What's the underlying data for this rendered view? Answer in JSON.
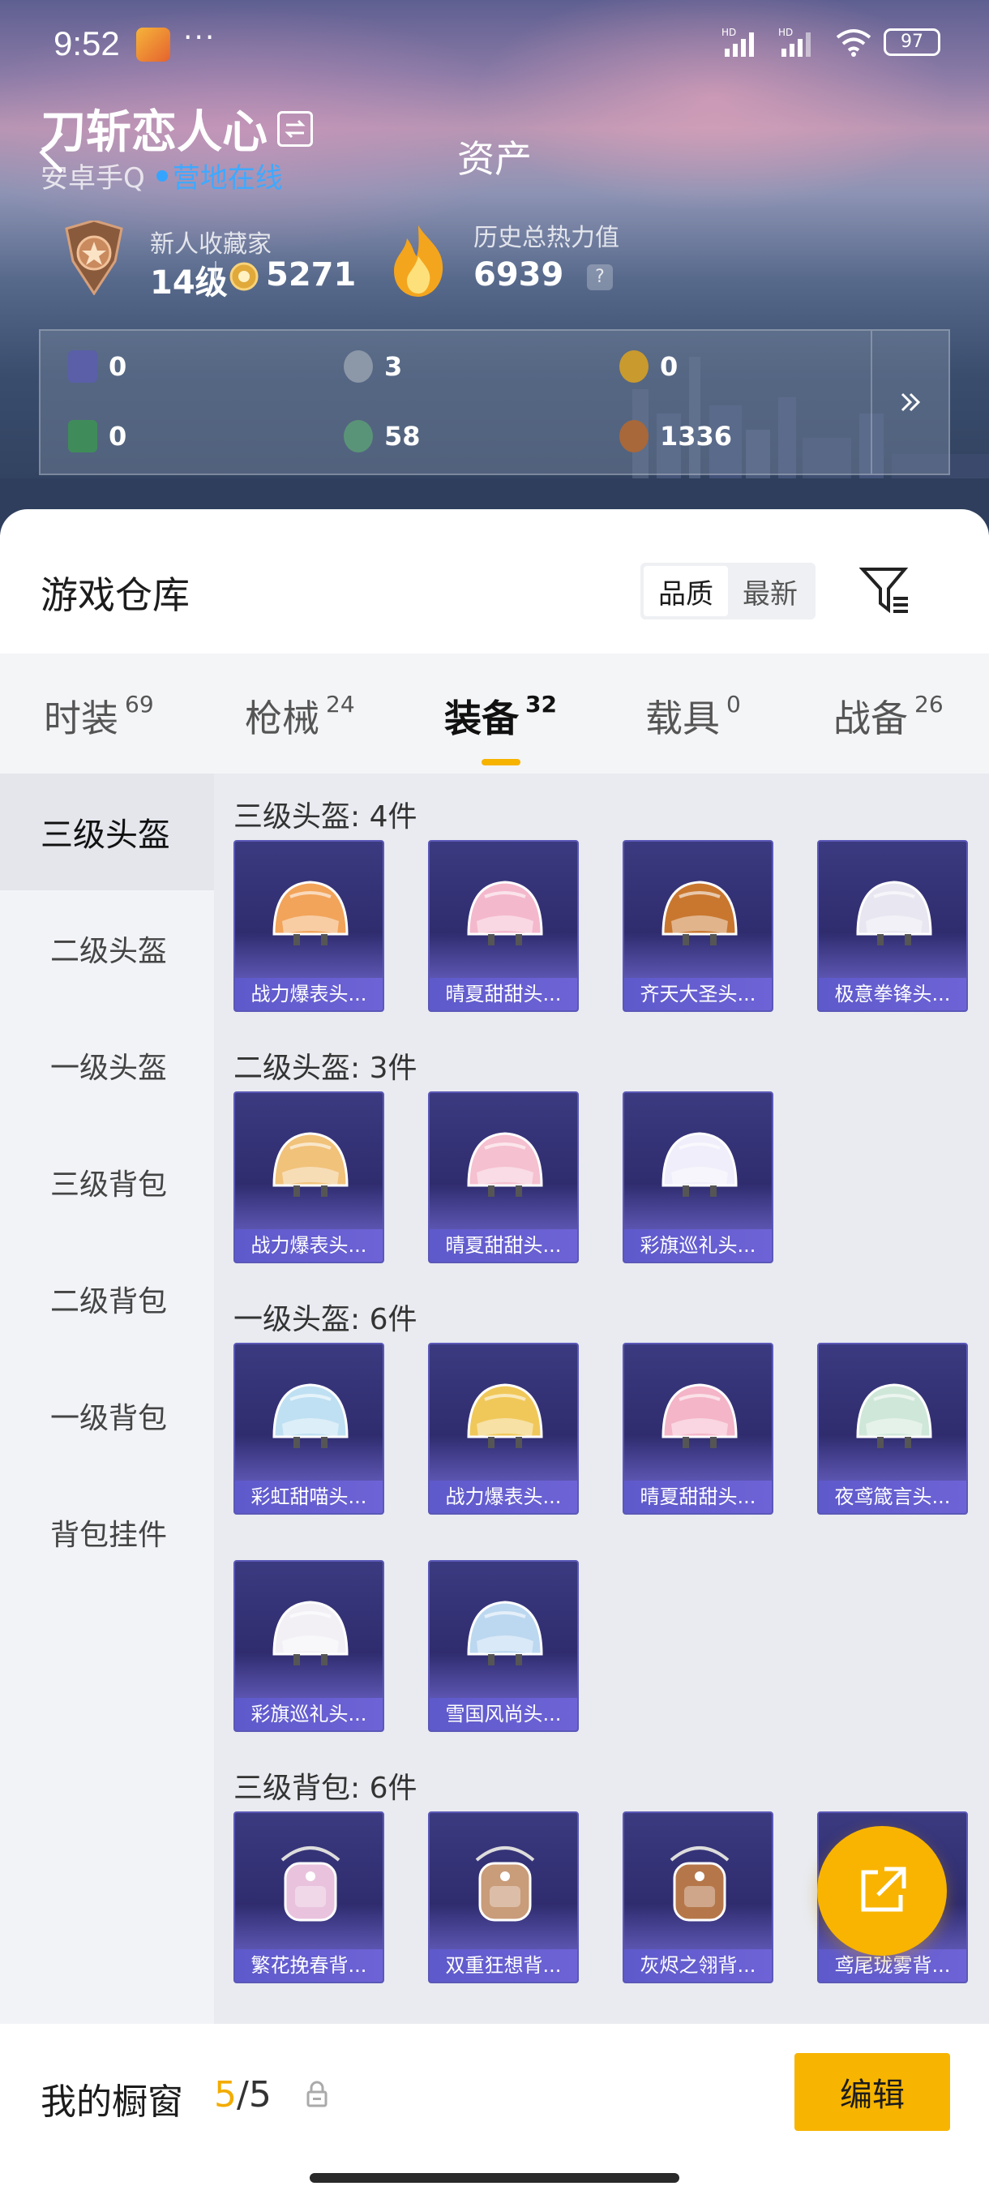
{
  "status_bar": {
    "time": "9:52",
    "dots": "···",
    "network1": "HD",
    "network2": "HD",
    "battery": "97"
  },
  "header": {
    "title": "资产",
    "username": "刀斩恋人心",
    "platform": "安卓手Q",
    "online_status": "营地在线",
    "rank_title": "新人收藏家",
    "rank_level": "14级",
    "rank_points": "5271",
    "heat_title": "历史总热力值",
    "heat_value": "6939",
    "help": "?"
  },
  "currencies": [
    {
      "icon": "card-icon",
      "value": "0",
      "color": "#5a5fa8"
    },
    {
      "icon": "silver-coin-icon",
      "value": "3",
      "color": "#8c97a8"
    },
    {
      "icon": "gold-coin-icon",
      "value": "0",
      "color": "#c99a2e"
    },
    {
      "icon": "green-card-icon",
      "value": "0",
      "color": "#3f8c5a"
    },
    {
      "icon": "green-orb-icon",
      "value": "58",
      "color": "#5a9478"
    },
    {
      "icon": "bronze-coin-icon",
      "value": "1336",
      "color": "#a8683a"
    }
  ],
  "warehouse": {
    "title": "游戏仓库",
    "sort_options": [
      "品质",
      "最新"
    ],
    "active_sort": "品质"
  },
  "tabs": [
    {
      "label": "时装",
      "count": "69"
    },
    {
      "label": "枪械",
      "count": "24"
    },
    {
      "label": "装备",
      "count": "32"
    },
    {
      "label": "载具",
      "count": "0"
    },
    {
      "label": "战备",
      "count": "26"
    }
  ],
  "active_tab": "装备",
  "sidebar": [
    "三级头盔",
    "二级头盔",
    "一级头盔",
    "三级背包",
    "二级背包",
    "一级背包",
    "背包挂件"
  ],
  "sections": [
    {
      "title": "三级头盔: 4件",
      "items": [
        "战力爆表头...",
        "晴夏甜甜头...",
        "齐天大圣头...",
        "极意拳锋头..."
      ]
    },
    {
      "title": "二级头盔: 3件",
      "items": [
        "战力爆表头...",
        "晴夏甜甜头...",
        "彩旗巡礼头..."
      ]
    },
    {
      "title": "一级头盔: 6件",
      "items": [
        "彩虹甜喵头...",
        "战力爆表头...",
        "晴夏甜甜头...",
        "夜鸢箴言头...",
        "彩旗巡礼头...",
        "雪国风尚头..."
      ]
    },
    {
      "title": "三级背包: 6件",
      "items": [
        "繁花挽春背...",
        "双重狂想背...",
        "灰烬之翎背...",
        "鸢尾珑雾背..."
      ]
    }
  ],
  "item_colors": [
    "#f2a45a",
    "#f4b8cc",
    "#c9772f",
    "#e8e6f0",
    "#f1c27a",
    "#f5c0d0",
    "#efeefa",
    "#bfe0f2",
    "#f0c85a",
    "#f4b5c8",
    "#cfe7d8",
    "#f2f0f5",
    "#bcd8f0",
    "#e9c3de",
    "#c99c7a",
    "#b5774a",
    "#5b90c8"
  ],
  "bottom": {
    "showcase_label": "我的橱窗",
    "showcase_used": "5",
    "showcase_total": "/5",
    "edit_label": "编辑"
  }
}
